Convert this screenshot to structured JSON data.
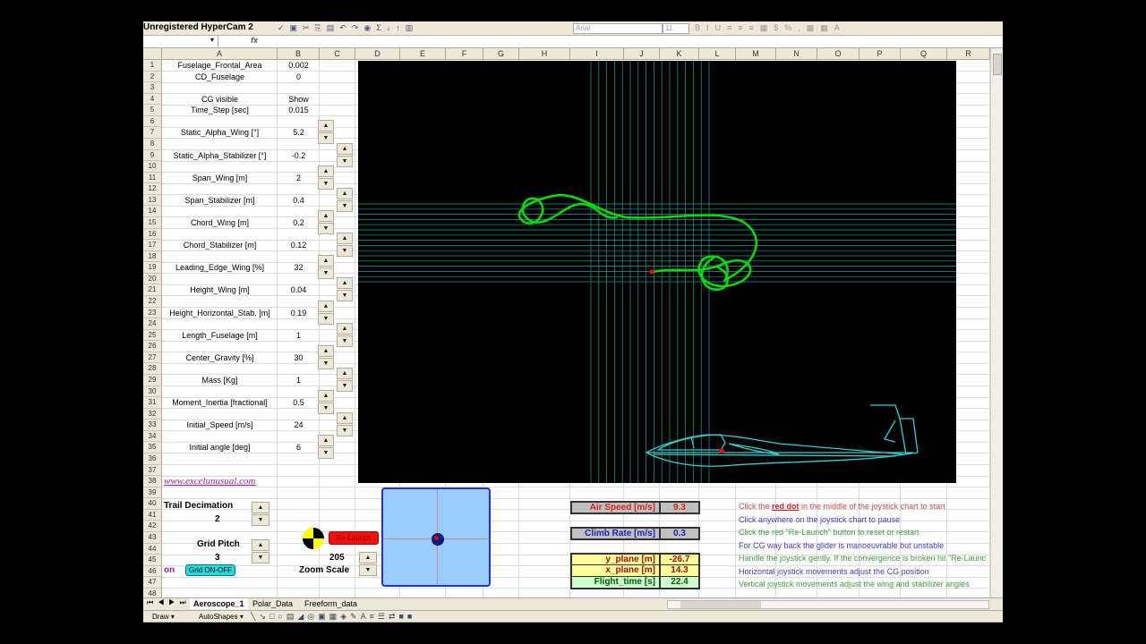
{
  "window": {
    "title": "Unregistered HyperCam 2",
    "font_name": "Arial",
    "font_size": "11",
    "formula_icon": "fx"
  },
  "columns": [
    "A",
    "B",
    "C",
    "D",
    "E",
    "F",
    "G",
    "H",
    "I",
    "J",
    "K",
    "L",
    "M",
    "N",
    "O",
    "P",
    "Q",
    "R"
  ],
  "params": [
    {
      "row": 1,
      "label": "Fuselage_Frontal_Area",
      "value": "0.002"
    },
    {
      "row": 2,
      "label": "CD_Fuselage",
      "value": "0"
    },
    {
      "row": 4,
      "label": "CG visible",
      "value": "Show"
    },
    {
      "row": 5,
      "label": "Time_Step [sec]",
      "value": "0.015"
    },
    {
      "row": 7,
      "label": "Static_Alpha_Wing [°]",
      "value": "5.2"
    },
    {
      "row": 9,
      "label": "Static_Alpha_Stabilizer [°]",
      "value": "-0.2"
    },
    {
      "row": 11,
      "label": "Span_Wing [m]",
      "value": "2"
    },
    {
      "row": 13,
      "label": "Span_Stabilizer [m]",
      "value": "0.4"
    },
    {
      "row": 15,
      "label": "Chord_Wing [m]",
      "value": "0.2"
    },
    {
      "row": 17,
      "label": "Chord_Stabilizer [m]",
      "value": "0.12"
    },
    {
      "row": 19,
      "label": "Leading_Edge_Wing [%]",
      "value": "32"
    },
    {
      "row": 21,
      "label": "Height_Wing [m]",
      "value": "0.04"
    },
    {
      "row": 23,
      "label": "Height_Horizontal_Stab. [m]",
      "value": "0.19"
    },
    {
      "row": 25,
      "label": "Length_Fuselage [m]",
      "value": "1"
    },
    {
      "row": 27,
      "label": "Center_Gravity [%]",
      "value": "30"
    },
    {
      "row": 29,
      "label": "Mass [Kg]",
      "value": "1"
    },
    {
      "row": 31,
      "label": "Moment_Inertia [fractional]",
      "value": "0.5"
    },
    {
      "row": 33,
      "label": "Initial_Speed [m/s]",
      "value": "24"
    },
    {
      "row": 35,
      "label": "Initial angle [deg]",
      "value": "6"
    }
  ],
  "link": "www.excelunusual.com",
  "controls": {
    "trail_label": "Trail Decimation",
    "trail_value": "2",
    "grid_label": "Grid Pitch",
    "grid_value": "3",
    "grid_state": "on",
    "grid_button": "Grid ON-OFF",
    "relaunch": "Re-Launch",
    "zoom_value": "205",
    "zoom_label": "Zoom Scale"
  },
  "readouts": [
    {
      "label": "Air Speed [m/s]",
      "value": "9.3",
      "bg": "#c0c0c0",
      "color": "#e02020"
    },
    {
      "label": "Climb Rate [m/s]",
      "value": "0.3",
      "bg": "#c0c0c0",
      "color": "#2020c0"
    },
    {
      "label": "y_plane [m]",
      "value": "-26.7",
      "bg": "#ffff99",
      "color": "#a01010"
    },
    {
      "label": "x_plane [m]",
      "value": "14.3",
      "bg": "#ffff99",
      "color": "#a01010"
    },
    {
      "label": "Flight_time [s]",
      "value": "22.4",
      "bg": "#ccffcc",
      "color": "#006000"
    }
  ],
  "instructions": [
    {
      "pre": "Click the ",
      "em": "red dot",
      "post": " in the middle of the joystick chart to start",
      "color": "#c05050"
    },
    {
      "pre": "Click anywhere on the joystick chart to pause",
      "color": "#4040c0"
    },
    {
      "pre": "Click the red \"Re-Launch\" button to reset or restart",
      "color": "#40a040"
    },
    {
      "pre": "For CG way back the glider is manoeuvrable but unstable",
      "color": "#4040c0"
    },
    {
      "pre": "Handle the joystick gently. If the convergence is broken hit \"Re-Launc",
      "color": "#40a040"
    },
    {
      "pre": "Horizontal joystick movements adjust the CG position",
      "color": "#4040c0"
    },
    {
      "pre": "Vertical joystick movements adjust the wing and stabilizer angles",
      "color": "#40a040"
    }
  ],
  "sheets": [
    "Aeroscope_1",
    "Polar_Data",
    "Freeform_data"
  ],
  "drawbar": {
    "draw": "Draw ▾",
    "autoshapes": "AutoShapes ▾"
  },
  "colors": {
    "chart_bg": "#000000",
    "trail": "#00e000",
    "grid": "#20a0a0",
    "glider": "#30d0d0",
    "joystick": "#99ccff"
  }
}
